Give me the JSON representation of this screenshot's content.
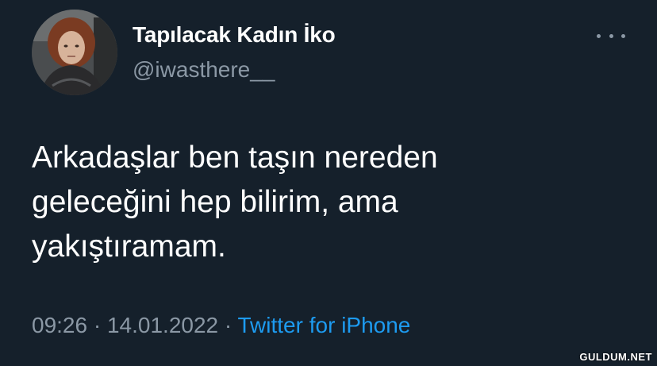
{
  "tweet": {
    "author": {
      "display_name": "Tapılacak Kadın İko",
      "handle": "@iwasthere__"
    },
    "text_lines": [
      "Arkadaşlar ben taşın nereden",
      "geleceğini hep bilirim, ama",
      "yakıştıramam."
    ],
    "time": "09:26",
    "date": "14.01.2022",
    "separator": "·",
    "source": "Twitter for iPhone"
  },
  "watermark": "GULDUM.NET",
  "icons": {
    "more": "more-horizontal-icon"
  },
  "colors": {
    "background": "#15202b",
    "primary_text": "#ffffff",
    "secondary_text": "#8b98a5",
    "link": "#1d9bf0"
  }
}
